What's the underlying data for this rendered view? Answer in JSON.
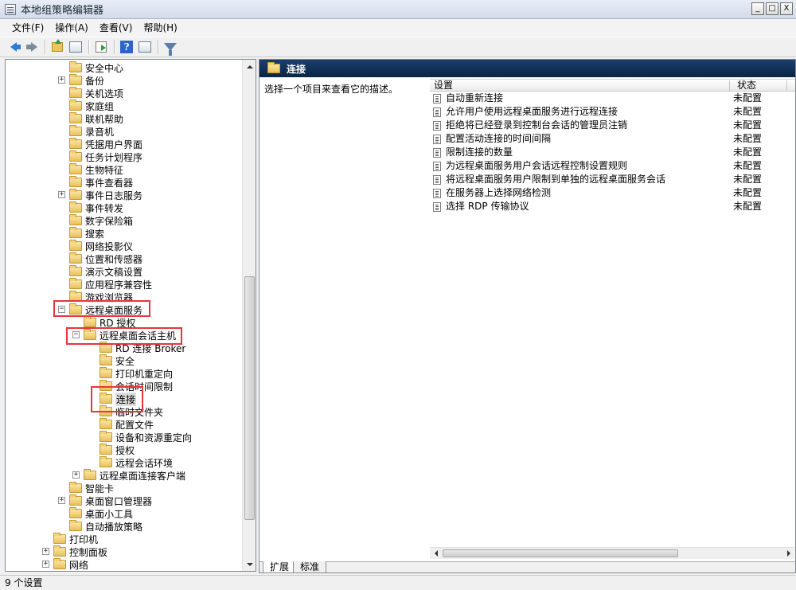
{
  "window": {
    "title": "本地组策略编辑器",
    "minimize": "_",
    "maximize": "□",
    "close": "X"
  },
  "menu": {
    "file": "文件(F)",
    "action": "操作(A)",
    "view": "查看(V)",
    "help": "帮助(H)"
  },
  "toolbar": {
    "help_glyph": "?"
  },
  "tree": {
    "items": [
      {
        "label": "安全中心"
      },
      {
        "label": "备份",
        "expander": "+"
      },
      {
        "label": "关机选项"
      },
      {
        "label": "家庭组"
      },
      {
        "label": "联机帮助"
      },
      {
        "label": "录音机"
      },
      {
        "label": "凭据用户界面"
      },
      {
        "label": "任务计划程序"
      },
      {
        "label": "生物特征"
      },
      {
        "label": "事件查看器"
      },
      {
        "label": "事件日志服务",
        "expander": "+"
      },
      {
        "label": "事件转发"
      },
      {
        "label": "数字保险箱"
      },
      {
        "label": "搜索"
      },
      {
        "label": "网络投影仪"
      },
      {
        "label": "位置和传感器"
      },
      {
        "label": "演示文稿设置"
      },
      {
        "label": "应用程序兼容性"
      },
      {
        "label": "游戏浏览器"
      },
      {
        "label": "远程桌面服务",
        "expander": "−"
      },
      {
        "label": "RD 授权"
      },
      {
        "label": "远程桌面会话主机",
        "expander": "−"
      },
      {
        "label": "RD 连接 Broker"
      },
      {
        "label": "安全"
      },
      {
        "label": "打印机重定向"
      },
      {
        "label": "会话时间限制"
      },
      {
        "label": "连接"
      },
      {
        "label": "临时文件夹"
      },
      {
        "label": "配置文件"
      },
      {
        "label": "设备和资源重定向"
      },
      {
        "label": "授权"
      },
      {
        "label": "远程会话环境"
      },
      {
        "label": "远程桌面连接客户端",
        "expander": "+"
      },
      {
        "label": "智能卡"
      },
      {
        "label": "桌面窗口管理器",
        "expander": "+"
      },
      {
        "label": "桌面小工具"
      },
      {
        "label": "自动播放策略"
      },
      {
        "label": "打印机"
      },
      {
        "label": "控制面板",
        "expander": "+"
      },
      {
        "label": "网络",
        "expander": "+"
      },
      {
        "label": "系统",
        "expander": "+"
      }
    ]
  },
  "right": {
    "header_title": "连接",
    "description": "选择一个项目来查看它的描述。",
    "columns": {
      "setting": "设置",
      "state": "状态"
    },
    "rows": [
      {
        "name": "自动重新连接",
        "state": "未配置"
      },
      {
        "name": "允许用户使用远程桌面服务进行远程连接",
        "state": "未配置"
      },
      {
        "name": "拒绝将已经登录到控制台会话的管理员注销",
        "state": "未配置"
      },
      {
        "name": "配置活动连接的时间间隔",
        "state": "未配置"
      },
      {
        "name": "限制连接的数量",
        "state": "未配置"
      },
      {
        "name": "为远程桌面服务用户会话远程控制设置规则",
        "state": "未配置"
      },
      {
        "name": "将远程桌面服务用户限制到单独的远程桌面服务会话",
        "state": "未配置"
      },
      {
        "name": "在服务器上选择网络检测",
        "state": "未配置"
      },
      {
        "name": "选择 RDP 传输协议",
        "state": "未配置"
      }
    ],
    "tabs": {
      "extended": "扩展",
      "standard": "标准"
    }
  },
  "status": {
    "text": "9 个设置"
  },
  "colors": {
    "highlight": "#e8353b",
    "header_bg": "#0a2546"
  }
}
